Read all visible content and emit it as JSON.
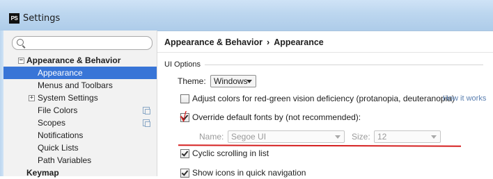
{
  "window": {
    "title": "Settings",
    "app_icon": "PS"
  },
  "sidebar": {
    "search": {
      "value": "",
      "placeholder": ""
    },
    "items": [
      {
        "label": "Appearance & Behavior",
        "expander": "−",
        "bold": true
      },
      {
        "label": "Appearance",
        "selected": true
      },
      {
        "label": "Menus and Toolbars"
      },
      {
        "label": "System Settings",
        "expander": "+"
      },
      {
        "label": "File Colors",
        "copy_icon": true
      },
      {
        "label": "Scopes",
        "copy_icon": true
      },
      {
        "label": "Notifications"
      },
      {
        "label": "Quick Lists"
      },
      {
        "label": "Path Variables"
      },
      {
        "label": "Keymap",
        "bold": true
      }
    ]
  },
  "breadcrumb": {
    "parent": "Appearance & Behavior",
    "separator": "›",
    "current": "Appearance"
  },
  "ui_options": {
    "section_title": "UI Options",
    "theme": {
      "label": "Theme:",
      "value": "Windows"
    },
    "adjust_colors": {
      "label": "Adjust colors for red-green vision deficiency (protanopia, deuteranopia)",
      "checked": false,
      "link": "How it works"
    },
    "override_fonts": {
      "label": "Override default fonts by (not recommended):",
      "checked": true
    },
    "font_name": {
      "label": "Name:",
      "value": "Segoe UI"
    },
    "font_size": {
      "label": "Size:",
      "value": "12"
    },
    "cyclic_scrolling": {
      "label": "Cyclic scrolling in list",
      "checked": true
    },
    "show_icons": {
      "label": "Show icons in quick navigation",
      "checked": true
    }
  },
  "annotation": {
    "mark": "√",
    "color": "#d31b1b"
  },
  "colors": {
    "selection": "#3875d7",
    "titlebar": "#bcd6ef",
    "link": "#5a7fb0"
  }
}
